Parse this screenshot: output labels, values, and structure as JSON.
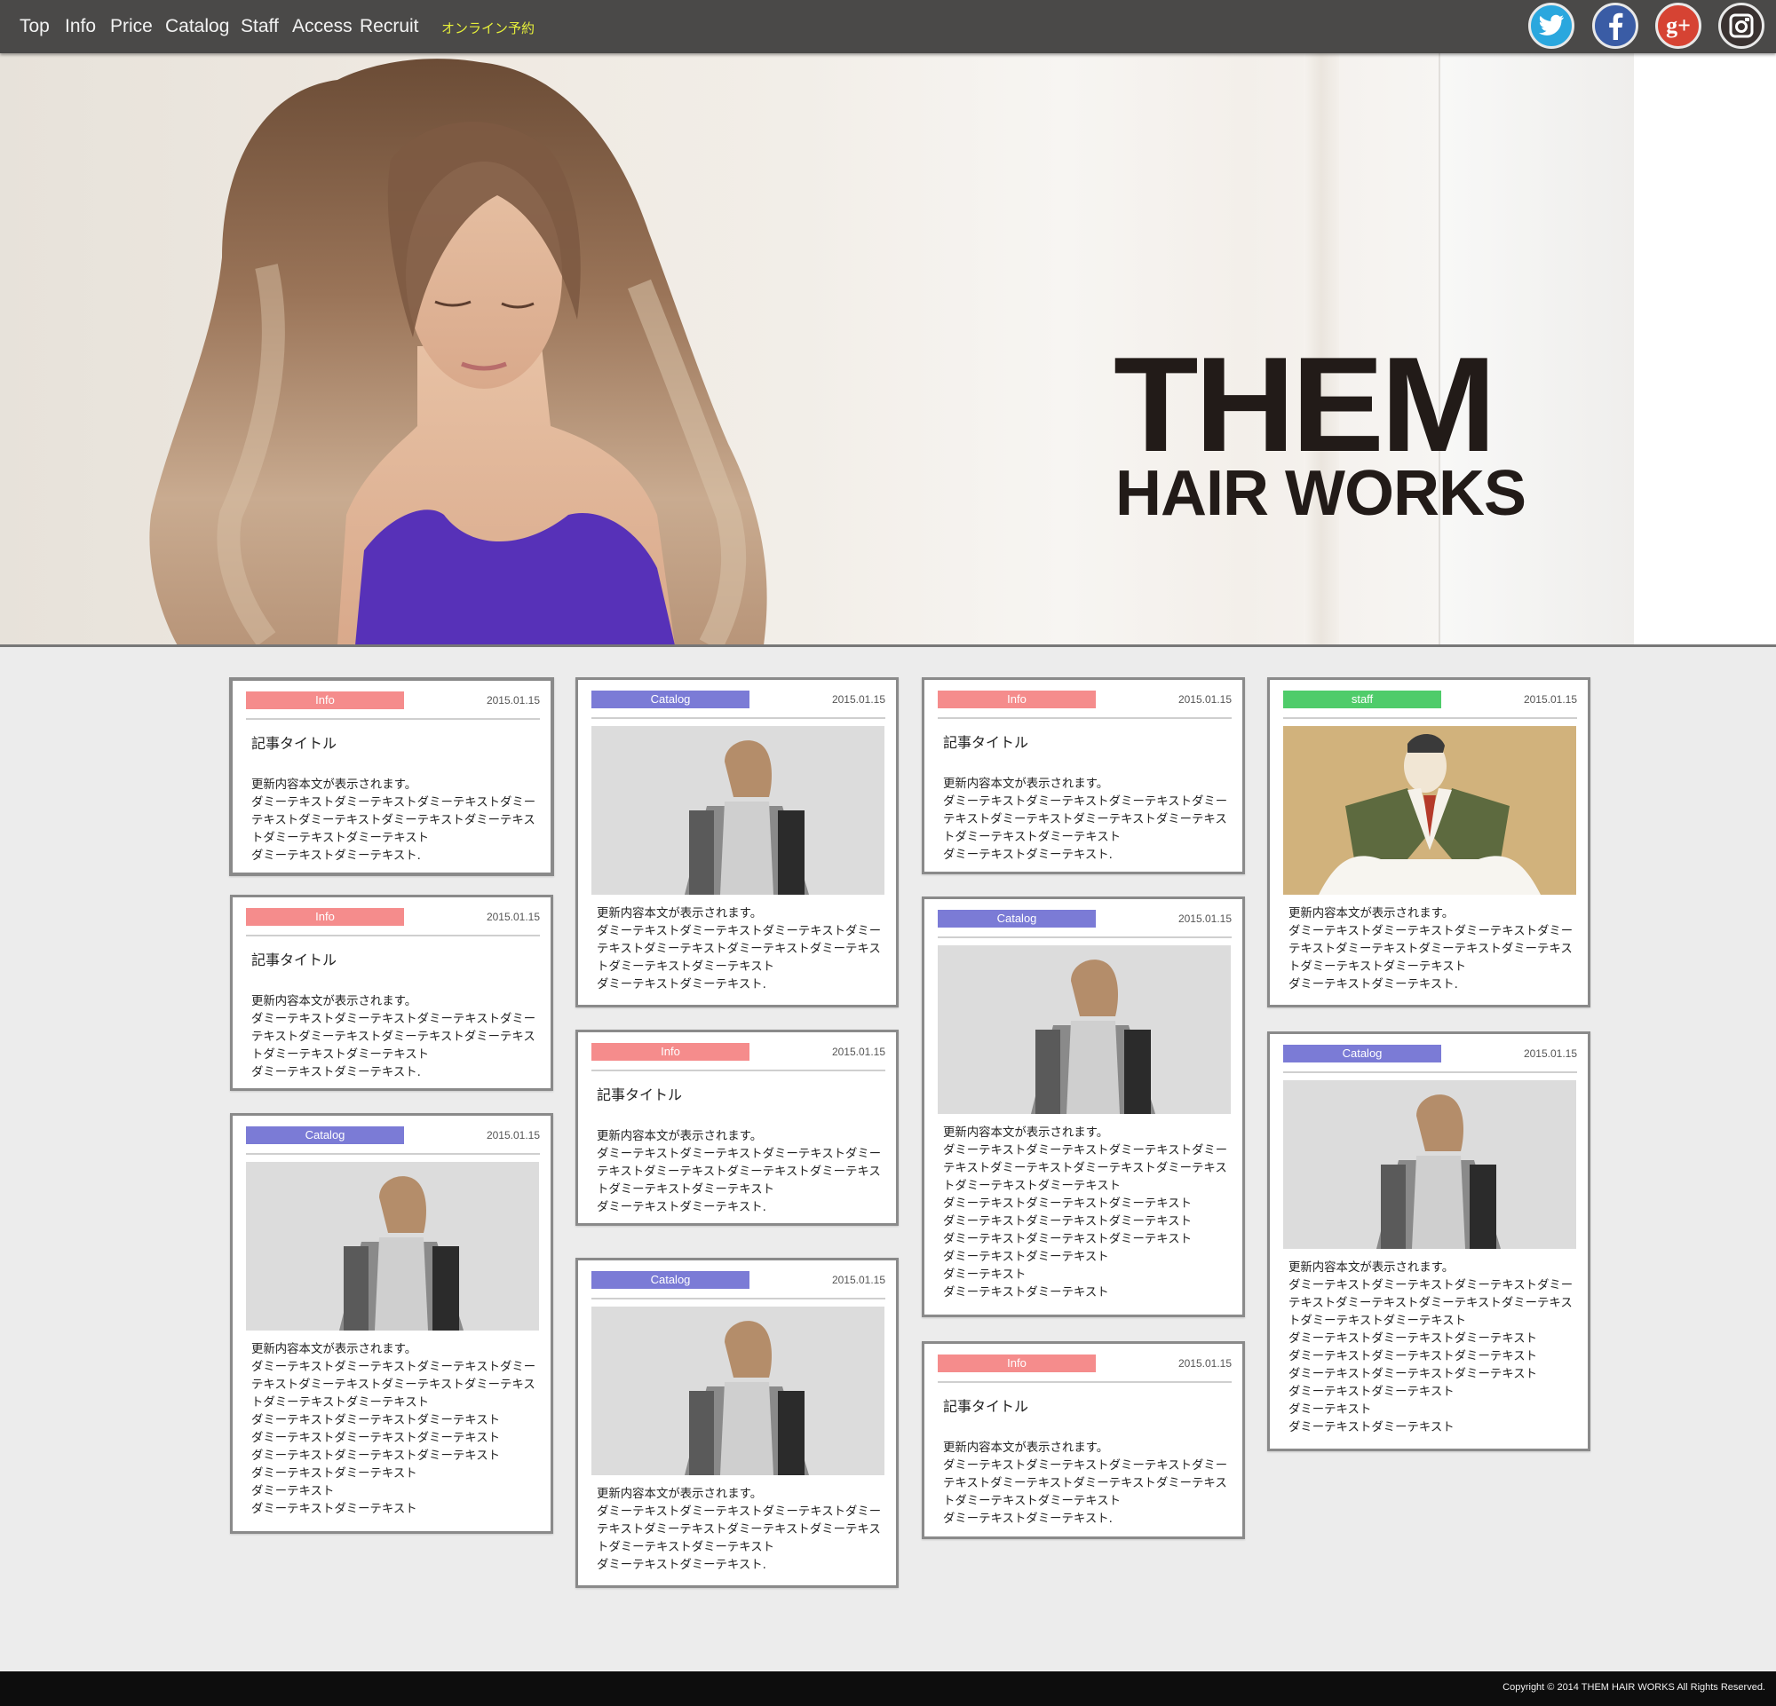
{
  "nav": {
    "items": [
      "Top",
      "Info",
      "Price",
      "Catalog",
      "Staff",
      "Access",
      "Recruit"
    ],
    "reserve": "オンライン予約"
  },
  "social": [
    "twitter-icon",
    "facebook-icon",
    "google-plus-icon",
    "instagram-icon"
  ],
  "hero": {
    "logo_line1": "THEM",
    "logo_line2": "HAIR WORKS"
  },
  "colors": {
    "info": "#f58c8c",
    "catalog": "#7b7bd6",
    "staff": "#4fcc6a",
    "nav_bg": "#4a4948",
    "reserve": "#e6ef3a"
  },
  "cards": [
    {
      "tag": "Info",
      "date": "2015.01.15",
      "title": "記事タイトル",
      "text": "更新内容本文が表示されます。\nダミーテキストダミーテキストダミーテキストダミーテキストダミーテキストダミーテキストダミーテキストダミーテキストダミーテキスト\nダミーテキストダミーテキスト."
    },
    {
      "tag": "Info",
      "date": "2015.01.15",
      "title": "記事タイトル",
      "text": "更新内容本文が表示されます。\nダミーテキストダミーテキストダミーテキストダミーテキストダミーテキストダミーテキストダミーテキストダミーテキストダミーテキスト\nダミーテキストダミーテキスト."
    },
    {
      "tag": "Catalog",
      "date": "2015.01.15",
      "text": "更新内容本文が表示されます。\nダミーテキストダミーテキストダミーテキストダミーテキストダミーテキストダミーテキストダミーテキストダミーテキストダミーテキスト\nダミーテキストダミーテキストダミーテキスト\nダミーテキストダミーテキストダミーテキスト\nダミーテキストダミーテキストダミーテキスト\nダミーテキストダミーテキスト\nダミーテキスト\nダミーテキストダミーテキスト"
    },
    {
      "tag": "Catalog",
      "date": "2015.01.15",
      "text": "更新内容本文が表示されます。\nダミーテキストダミーテキストダミーテキストダミーテキストダミーテキストダミーテキストダミーテキストダミーテキストダミーテキスト\nダミーテキストダミーテキスト."
    },
    {
      "tag": "Info",
      "date": "2015.01.15",
      "title": "記事タイトル",
      "text": "更新内容本文が表示されます。\nダミーテキストダミーテキストダミーテキストダミーテキストダミーテキストダミーテキストダミーテキストダミーテキストダミーテキスト\nダミーテキストダミーテキスト."
    },
    {
      "tag": "Catalog",
      "date": "2015.01.15",
      "text": "更新内容本文が表示されます。\nダミーテキストダミーテキストダミーテキストダミーテキストダミーテキストダミーテキストダミーテキストダミーテキストダミーテキスト\nダミーテキストダミーテキスト."
    },
    {
      "tag": "Info",
      "date": "2015.01.15",
      "title": "記事タイトル",
      "text": "更新内容本文が表示されます。\nダミーテキストダミーテキストダミーテキストダミーテキストダミーテキストダミーテキストダミーテキストダミーテキストダミーテキスト\nダミーテキストダミーテキスト."
    },
    {
      "tag": "Catalog",
      "date": "2015.01.15",
      "text": "更新内容本文が表示されます。\nダミーテキストダミーテキストダミーテキストダミーテキストダミーテキストダミーテキストダミーテキストダミーテキストダミーテキスト\nダミーテキストダミーテキストダミーテキスト\nダミーテキストダミーテキストダミーテキスト\nダミーテキストダミーテキストダミーテキスト\nダミーテキストダミーテキスト\nダミーテキスト\nダミーテキストダミーテキスト"
    },
    {
      "tag": "Info",
      "date": "2015.01.15",
      "title": "記事タイトル",
      "text": "更新内容本文が表示されます。\nダミーテキストダミーテキストダミーテキストダミーテキストダミーテキストダミーテキストダミーテキストダミーテキストダミーテキスト\nダミーテキストダミーテキスト."
    },
    {
      "tag": "staff",
      "date": "2015.01.15",
      "text": "更新内容本文が表示されます。\nダミーテキストダミーテキストダミーテキストダミーテキストダミーテキストダミーテキストダミーテキストダミーテキストダミーテキスト\nダミーテキストダミーテキスト."
    },
    {
      "tag": "Catalog",
      "date": "2015.01.15",
      "text": "更新内容本文が表示されます。\nダミーテキストダミーテキストダミーテキストダミーテキストダミーテキストダミーテキストダミーテキストダミーテキストダミーテキスト\nダミーテキストダミーテキストダミーテキスト\nダミーテキストダミーテキストダミーテキスト\nダミーテキストダミーテキストダミーテキスト\nダミーテキストダミーテキスト\nダミーテキスト\nダミーテキストダミーテキスト"
    }
  ],
  "footer": {
    "copyright": "Copyright © 2014 THEM HAIR WORKS All Rights Reserved."
  }
}
